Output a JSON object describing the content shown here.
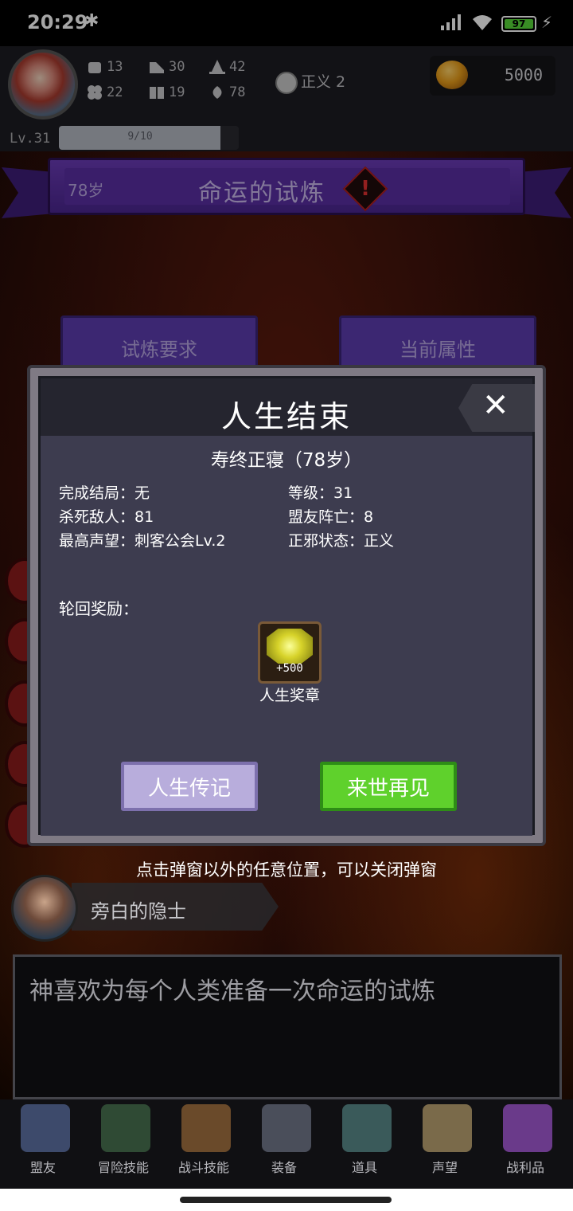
{
  "status_bar": {
    "time": "20:29",
    "battery": "97",
    "icons": [
      "bluetooth-icon",
      "signal-icon",
      "wifi-icon",
      "battery-icon",
      "charging-icon"
    ]
  },
  "player": {
    "stats": [
      {
        "icon": "fist-icon",
        "value": "13"
      },
      {
        "icon": "boot-icon",
        "value": "30"
      },
      {
        "icon": "wizard-hat-icon",
        "value": "42"
      },
      {
        "icon": "clover-icon",
        "value": "22"
      },
      {
        "icon": "book-icon",
        "value": "19"
      },
      {
        "icon": "leaf-icon",
        "value": "78"
      }
    ],
    "alignment_label": "正义 2",
    "gold": "5000",
    "level": "Lv.31",
    "xp_text": "9/10",
    "xp_fraction": 0.9
  },
  "banner": {
    "age": "78岁",
    "title": "命运的试炼"
  },
  "tabs": [
    "试炼要求",
    "当前属性"
  ],
  "dialog": {
    "title": "人生结束",
    "subtitle": "寿终正寝（78岁）",
    "rows_left": [
      "完成结局：无",
      "杀死敌人：81",
      "最高声望：刺客公会Lv.2"
    ],
    "rows_right": [
      "等级：31",
      "盟友阵亡：8",
      "正邪状态：正义"
    ],
    "reward_label": "轮回奖励：",
    "reward": {
      "amount": "+500",
      "name": "人生奖章"
    },
    "btn_biography": "人生传记",
    "btn_next_life": "来世再见"
  },
  "hint": "点击弹窗以外的任意位置，可以关闭弹窗",
  "narrator": {
    "name": "旁白的隐士",
    "text": "神喜欢为每个人类准备一次命运的试炼"
  },
  "nav": [
    {
      "label": "盟友",
      "color": "#3d4a6b"
    },
    {
      "label": "冒险技能",
      "color": "#2f4a34"
    },
    {
      "label": "战斗技能",
      "color": "#6a4a2a"
    },
    {
      "label": "装备",
      "color": "#4a4e5a"
    },
    {
      "label": "道具",
      "color": "#3a5a5a"
    },
    {
      "label": "声望",
      "color": "#7a6a4a"
    },
    {
      "label": "战利品",
      "color": "#6a3a8a"
    }
  ]
}
